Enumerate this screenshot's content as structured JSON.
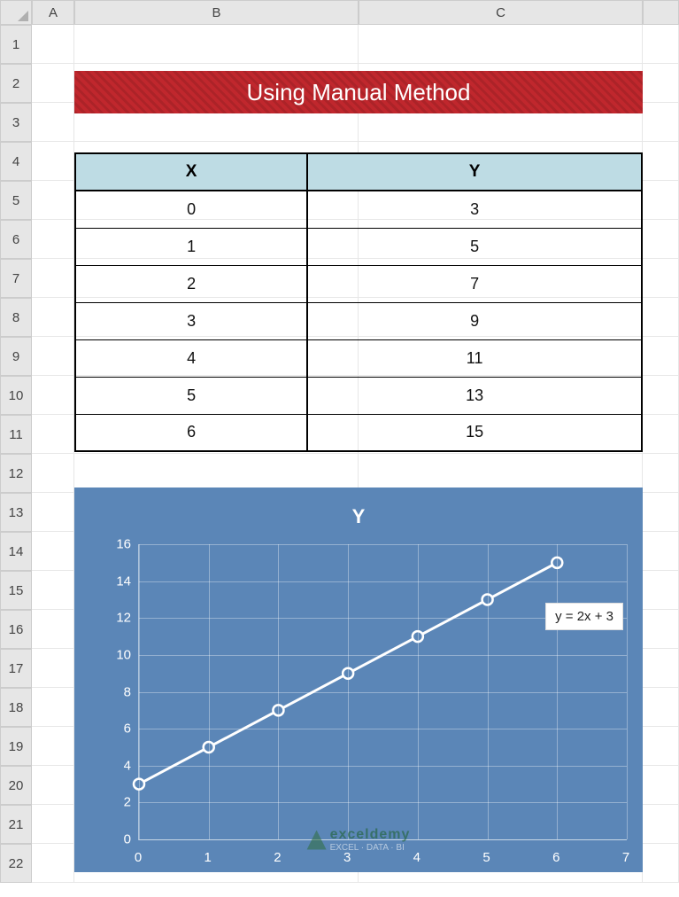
{
  "columns": [
    "A",
    "B",
    "C"
  ],
  "row_count": 22,
  "banner_title": "Using Manual Method",
  "table": {
    "headers": [
      "X",
      "Y"
    ],
    "rows": [
      {
        "x": 0,
        "y": 3
      },
      {
        "x": 1,
        "y": 5
      },
      {
        "x": 2,
        "y": 7
      },
      {
        "x": 3,
        "y": 9
      },
      {
        "x": 4,
        "y": 11
      },
      {
        "x": 5,
        "y": 13
      },
      {
        "x": 6,
        "y": 15
      }
    ]
  },
  "chart_data": {
    "type": "line",
    "title": "Y",
    "xlabel": "",
    "ylabel": "",
    "x": [
      0,
      1,
      2,
      3,
      4,
      5,
      6
    ],
    "y": [
      3,
      5,
      7,
      9,
      11,
      13,
      15
    ],
    "xlim": [
      0,
      7
    ],
    "ylim": [
      0,
      16
    ],
    "xticks": [
      0,
      1,
      2,
      3,
      4,
      5,
      6,
      7
    ],
    "yticks": [
      0,
      2,
      4,
      6,
      8,
      10,
      12,
      14,
      16
    ],
    "trendline_equation": "y = 2x + 3",
    "grid": true,
    "markers": true,
    "series_name": "Y"
  },
  "watermark": {
    "brand": "exceldemy",
    "tagline": "EXCEL · DATA · BI"
  }
}
